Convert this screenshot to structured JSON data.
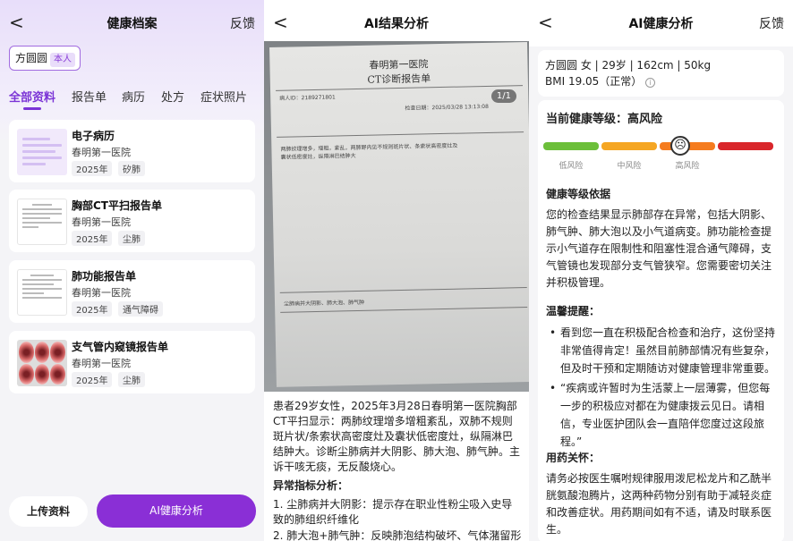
{
  "panel1": {
    "title": "健康档案",
    "back": "<",
    "feedback": "反馈",
    "patient": {
      "name": "方圆圆",
      "tag": "本人"
    },
    "tabs": [
      "全部资料",
      "报告单",
      "病历",
      "处方",
      "症状照片"
    ],
    "cards": [
      {
        "title": "电子病历",
        "hospital": "春明第一医院",
        "year": "2025年",
        "keyword": "矽肺",
        "thumb": "doc"
      },
      {
        "title": "胸部CT平扫报告单",
        "hospital": "春明第一医院",
        "year": "2025年",
        "keyword": "尘肺",
        "thumb": "paper"
      },
      {
        "title": "肺功能报告单",
        "hospital": "春明第一医院",
        "year": "2025年",
        "keyword": "通气障碍",
        "thumb": "paper"
      },
      {
        "title": "支气管内窥镜报告单",
        "hospital": "春明第一医院",
        "year": "2025年",
        "keyword": "尘肺",
        "thumb": "endo"
      }
    ],
    "upload": "上传资料",
    "ai_button": "AI健康分析"
  },
  "panel2": {
    "title": "AI结果分析",
    "back": "<",
    "page": "1/1",
    "scan": {
      "hospital": "春明第一医院",
      "report": "CT诊断报告单",
      "id": "病人ID：2189271801",
      "date": "检查日期：2025/03/28 13:13:08",
      "finding": "两肺纹理增多，增粗，紊乱，两肺野内见不规则斑片状、条索状高密度灶及囊状低密度灶，纵隔淋巴结肿大",
      "conclusion": "尘肺病并大阴影、肺大泡、肺气肿"
    },
    "summary": "患者29岁女性，2025年3月28日春明第一医院胸部CT平扫显示：两肺纹理增多增粗紊乱，双肺不规则斑片状/条索状高密度灶及囊状低密度灶，纵隔淋巴结肿大。诊断尘肺病并大阴影、肺大泡、肺气肿。主诉干咳无痰，无反酸烧心。",
    "abn_heading": "异常指标分析：",
    "abn": [
      "1. 尘肺病并大阴影：提示存在职业性粉尘吸入史导致的肺组织纤维化",
      "2. 肺大泡+肺气肿：反映肺泡结构破坏、气体潴留形"
    ]
  },
  "panel3": {
    "title": "AI健康分析",
    "back": "<",
    "feedback": "反馈",
    "info_line1": "方圆圆 女 | 29岁 | 162cm | 50kg",
    "info_line2": "BMI 19.05（正常）",
    "level": "当前健康等级：高风险",
    "risk": {
      "labels": [
        "低风险",
        "中风险",
        "高风险",
        ""
      ],
      "colors": [
        "#6cbf3a",
        "#f5a623",
        "#f57c1f",
        "#d9262b"
      ],
      "current": 2
    },
    "basis_heading": "健康等级依据",
    "basis": "您的检查结果显示肺部存在异常，包括大阴影、肺气肿、肺大泡以及小气道病变。肺功能检查提示小气道存在限制性和阻塞性混合通气障碍，支气管镜也发现部分支气管狭窄。您需要密切关注并积极管理。",
    "tips_heading": "温馨提醒：",
    "tips": [
      "看到您一直在积极配合检查和治疗，这份坚持非常值得肯定！虽然目前肺部情况有些复杂，但及时干预和定期随访对健康管理非常重要。",
      "“疾病或许暂时为生活蒙上一层薄雾，但您每一步的积极应对都在为健康拨云见日。请相信，专业医护团队会一直陪伴您度过这段旅程。”"
    ],
    "med_heading": "用药关怀：",
    "med": "请务必按医生嘱咐规律服用泼尼松龙片和乙酰半胱氨酸泡腾片，这两种药物分别有助于减轻炎症和改善症状。用药期间如有不适，请及时联系医生。"
  }
}
